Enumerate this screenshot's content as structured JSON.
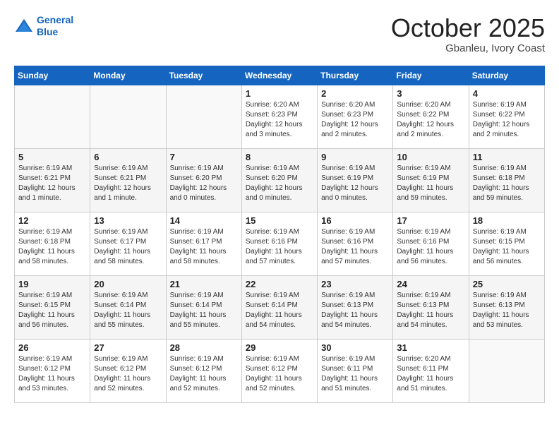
{
  "header": {
    "logo_line1": "General",
    "logo_line2": "Blue",
    "month": "October 2025",
    "location": "Gbanleu, Ivory Coast"
  },
  "days_of_week": [
    "Sunday",
    "Monday",
    "Tuesday",
    "Wednesday",
    "Thursday",
    "Friday",
    "Saturday"
  ],
  "weeks": [
    [
      {
        "day": "",
        "info": ""
      },
      {
        "day": "",
        "info": ""
      },
      {
        "day": "",
        "info": ""
      },
      {
        "day": "1",
        "info": "Sunrise: 6:20 AM\nSunset: 6:23 PM\nDaylight: 12 hours and 3 minutes."
      },
      {
        "day": "2",
        "info": "Sunrise: 6:20 AM\nSunset: 6:23 PM\nDaylight: 12 hours and 2 minutes."
      },
      {
        "day": "3",
        "info": "Sunrise: 6:20 AM\nSunset: 6:22 PM\nDaylight: 12 hours and 2 minutes."
      },
      {
        "day": "4",
        "info": "Sunrise: 6:19 AM\nSunset: 6:22 PM\nDaylight: 12 hours and 2 minutes."
      }
    ],
    [
      {
        "day": "5",
        "info": "Sunrise: 6:19 AM\nSunset: 6:21 PM\nDaylight: 12 hours and 1 minute."
      },
      {
        "day": "6",
        "info": "Sunrise: 6:19 AM\nSunset: 6:21 PM\nDaylight: 12 hours and 1 minute."
      },
      {
        "day": "7",
        "info": "Sunrise: 6:19 AM\nSunset: 6:20 PM\nDaylight: 12 hours and 0 minutes."
      },
      {
        "day": "8",
        "info": "Sunrise: 6:19 AM\nSunset: 6:20 PM\nDaylight: 12 hours and 0 minutes."
      },
      {
        "day": "9",
        "info": "Sunrise: 6:19 AM\nSunset: 6:19 PM\nDaylight: 12 hours and 0 minutes."
      },
      {
        "day": "10",
        "info": "Sunrise: 6:19 AM\nSunset: 6:19 PM\nDaylight: 11 hours and 59 minutes."
      },
      {
        "day": "11",
        "info": "Sunrise: 6:19 AM\nSunset: 6:18 PM\nDaylight: 11 hours and 59 minutes."
      }
    ],
    [
      {
        "day": "12",
        "info": "Sunrise: 6:19 AM\nSunset: 6:18 PM\nDaylight: 11 hours and 58 minutes."
      },
      {
        "day": "13",
        "info": "Sunrise: 6:19 AM\nSunset: 6:17 PM\nDaylight: 11 hours and 58 minutes."
      },
      {
        "day": "14",
        "info": "Sunrise: 6:19 AM\nSunset: 6:17 PM\nDaylight: 11 hours and 58 minutes."
      },
      {
        "day": "15",
        "info": "Sunrise: 6:19 AM\nSunset: 6:16 PM\nDaylight: 11 hours and 57 minutes."
      },
      {
        "day": "16",
        "info": "Sunrise: 6:19 AM\nSunset: 6:16 PM\nDaylight: 11 hours and 57 minutes."
      },
      {
        "day": "17",
        "info": "Sunrise: 6:19 AM\nSunset: 6:16 PM\nDaylight: 11 hours and 56 minutes."
      },
      {
        "day": "18",
        "info": "Sunrise: 6:19 AM\nSunset: 6:15 PM\nDaylight: 11 hours and 56 minutes."
      }
    ],
    [
      {
        "day": "19",
        "info": "Sunrise: 6:19 AM\nSunset: 6:15 PM\nDaylight: 11 hours and 56 minutes."
      },
      {
        "day": "20",
        "info": "Sunrise: 6:19 AM\nSunset: 6:14 PM\nDaylight: 11 hours and 55 minutes."
      },
      {
        "day": "21",
        "info": "Sunrise: 6:19 AM\nSunset: 6:14 PM\nDaylight: 11 hours and 55 minutes."
      },
      {
        "day": "22",
        "info": "Sunrise: 6:19 AM\nSunset: 6:14 PM\nDaylight: 11 hours and 54 minutes."
      },
      {
        "day": "23",
        "info": "Sunrise: 6:19 AM\nSunset: 6:13 PM\nDaylight: 11 hours and 54 minutes."
      },
      {
        "day": "24",
        "info": "Sunrise: 6:19 AM\nSunset: 6:13 PM\nDaylight: 11 hours and 54 minutes."
      },
      {
        "day": "25",
        "info": "Sunrise: 6:19 AM\nSunset: 6:13 PM\nDaylight: 11 hours and 53 minutes."
      }
    ],
    [
      {
        "day": "26",
        "info": "Sunrise: 6:19 AM\nSunset: 6:12 PM\nDaylight: 11 hours and 53 minutes."
      },
      {
        "day": "27",
        "info": "Sunrise: 6:19 AM\nSunset: 6:12 PM\nDaylight: 11 hours and 52 minutes."
      },
      {
        "day": "28",
        "info": "Sunrise: 6:19 AM\nSunset: 6:12 PM\nDaylight: 11 hours and 52 minutes."
      },
      {
        "day": "29",
        "info": "Sunrise: 6:19 AM\nSunset: 6:12 PM\nDaylight: 11 hours and 52 minutes."
      },
      {
        "day": "30",
        "info": "Sunrise: 6:19 AM\nSunset: 6:11 PM\nDaylight: 11 hours and 51 minutes."
      },
      {
        "day": "31",
        "info": "Sunrise: 6:20 AM\nSunset: 6:11 PM\nDaylight: 11 hours and 51 minutes."
      },
      {
        "day": "",
        "info": ""
      }
    ]
  ]
}
